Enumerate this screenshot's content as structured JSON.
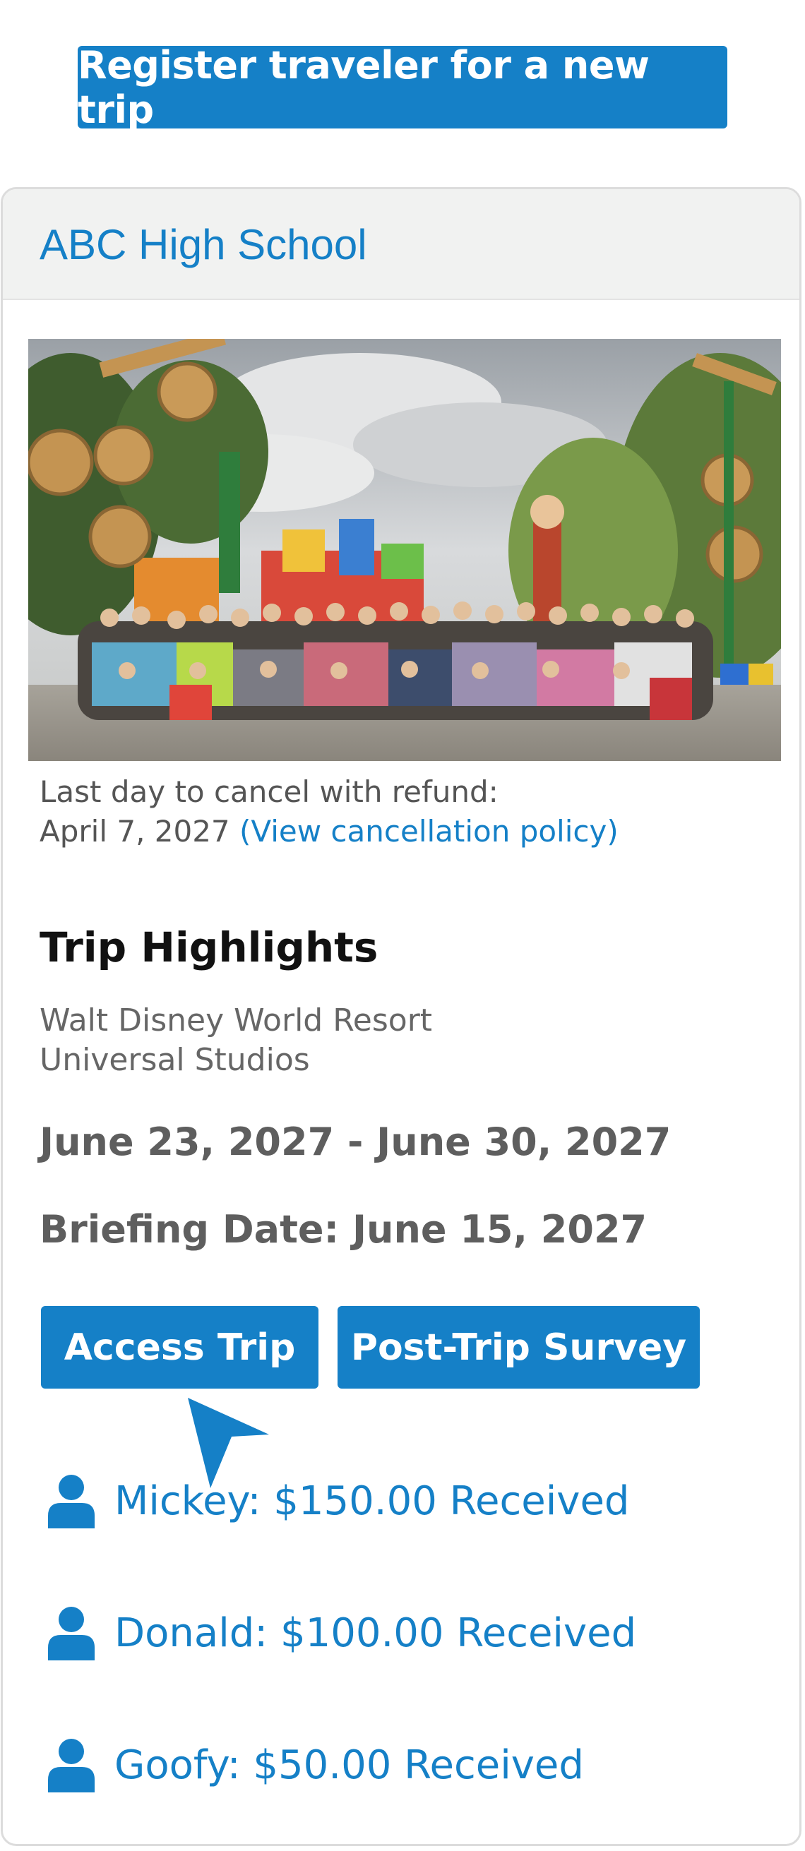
{
  "register_button": {
    "label": "Register traveler for a new trip"
  },
  "trip": {
    "school_name": "ABC High School",
    "cancellation": {
      "label": "Last day to cancel with refund:",
      "date": "April 7, 2027",
      "policy_link": "(View cancellation policy)"
    },
    "highlights": {
      "title": "Trip Highlights",
      "items": [
        "Walt Disney World Resort",
        "Universal Studios"
      ]
    },
    "dates": "June 23, 2027 - June 30, 2027",
    "briefing": "Briefing Date: June 15, 2027",
    "buttons": {
      "access": "Access Trip",
      "survey": "Post-Trip Survey"
    },
    "travelers": [
      {
        "label": "Mickey: $150.00 Received",
        "icon": "person-icon"
      },
      {
        "label": "Donald: $100.00 Received",
        "icon": "person-icon"
      },
      {
        "label": "Goofy: $50.00 Received",
        "icon": "person-icon"
      }
    ]
  },
  "colors": {
    "accent": "#1580c7",
    "header_bg": "#f1f2f1",
    "muted_text": "#5e5e5e"
  }
}
